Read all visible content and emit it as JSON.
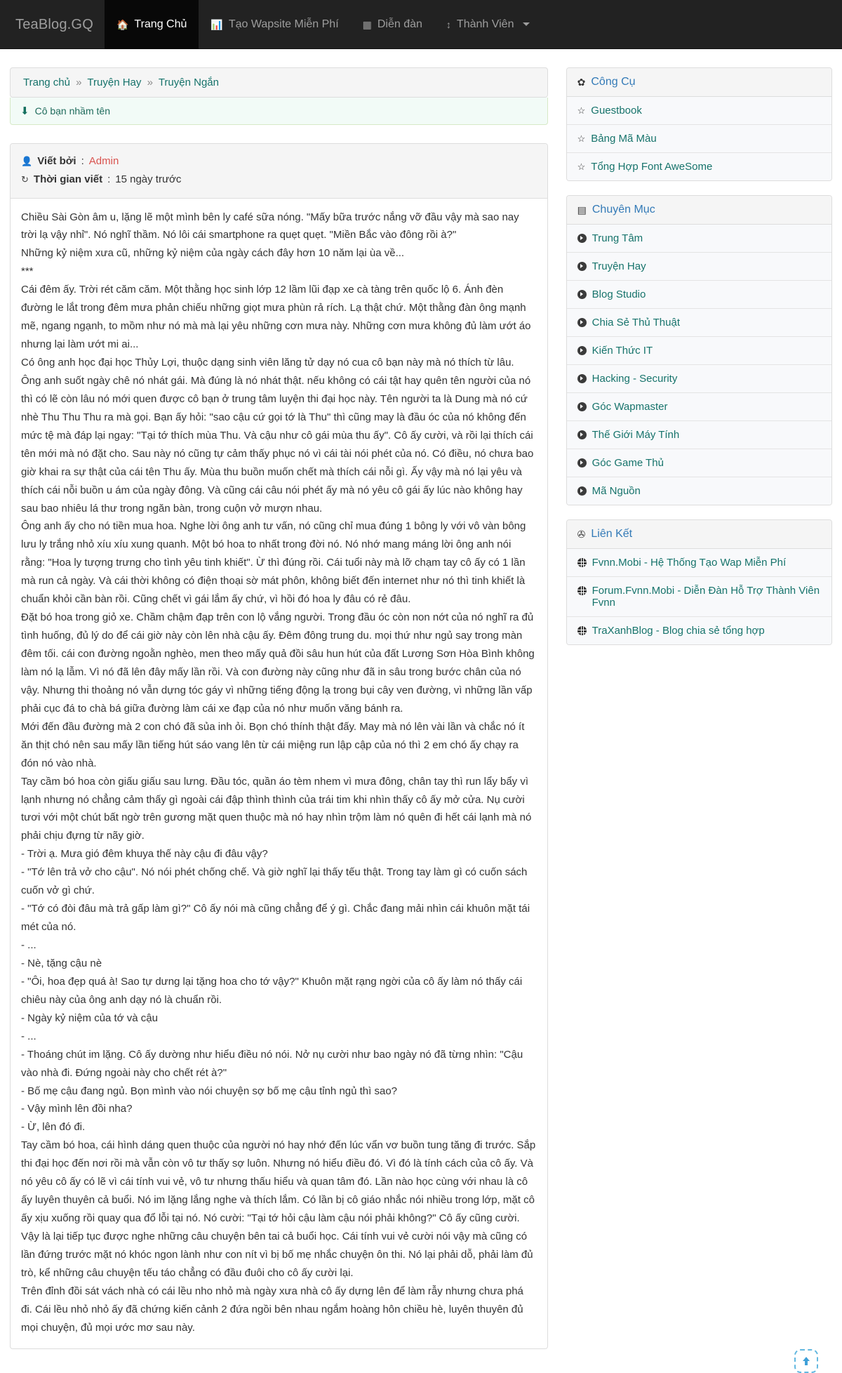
{
  "navbar": {
    "brand": "TeaBlog.GQ",
    "items": [
      {
        "label": "Trang Chủ",
        "icon": "home-icon",
        "glyph": "⌂",
        "active": true
      },
      {
        "label": "Tạo Wapsite Miễn Phí",
        "icon": "bar-chart-icon",
        "glyph": "ὌA",
        "active": false
      },
      {
        "label": "Diễn đàn",
        "icon": "table-icon",
        "glyph": "▦",
        "active": false
      },
      {
        "label": "Thành Viên",
        "icon": "arrows-v-icon",
        "glyph": "↕",
        "active": false,
        "caret": true
      }
    ]
  },
  "breadcrumb": {
    "items": [
      "Trang chủ",
      "Truyện Hay",
      "Truyện Ngắn"
    ],
    "separator": "»"
  },
  "post": {
    "title": "Cô bạn nhầm tên",
    "title_icon": "arrow-down-icon",
    "author_label": "Viết bởi",
    "author_name": "Admin",
    "time_label": "Thời gian viết",
    "time_value": "15 ngày trước",
    "paragraphs": [
      "Chiều Sài Gòn âm u, lặng lẽ một mình bên ly café sữa nóng. \"Mấy bữa trước nắng vỡ đầu vậy mà sao nay trời lạ vậy nhỉ\". Nó nghĩ thầm. Nó lôi cái smartphone ra quẹt quẹt. \"Miền Bắc vào đông rồi à?\"",
      "Những kỷ niệm xưa cũ, những kỷ niệm của ngày cách đây hơn 10 năm lại ùa về...",
      "***",
      "Cái đêm ấy. Trời rét căm căm. Một thằng học sinh lớp 12 lầm lũi đạp xe cà tàng trên quốc lộ 6. Ánh đèn đường le lắt trong đêm mưa phản chiếu những giọt mưa phùn rả rích. Lạ thật chứ. Một thằng đàn ông mạnh mẽ, ngang ngạnh, to mồm như nó mà mà lại yêu những cơn mưa này. Những cơn mưa không đủ làm ướt áo nhưng lại làm ướt mi ai...",
      "Có ông anh học đại học Thủy Lợi, thuộc dạng sinh viên lăng tử dạy nó cua cô bạn này mà nó thích từ lâu.",
      "Ông anh suốt ngày chê nó nhát gái. Mà đúng là nó nhát thật. nếu không có cái tật hay quên tên người của nó thì có lẽ còn lâu nó mới quen được cô bạn ở trung tâm luyện thi đại học này. Tên người ta là Dung mà nó cứ nhè Thu Thu Thu ra mà gọi. Bạn ấy hỏi: \"sao cậu cứ gọi tớ là Thu\" thì cũng may là đầu óc của nó không đến mức tệ mà đáp lại ngay: \"Tại tớ thích mùa Thu. Và cậu như cô gái mùa thu ấy\". Cô ấy cười, và rồi lại thích cái tên mới mà nó đặt cho. Sau này nó cũng tự cảm thấy phục nó vì cái tài nói phét của nó. Có điều, nó chưa bao giờ khai ra sự thật của cái tên Thu ấy. Mùa thu buồn muốn chết mà thích cái nỗi gì. Ấy vậy mà nó lại yêu và thích cái nỗi buồn u ám của ngày đông. Và cũng cái câu nói phét ấy mà nó yêu cô gái ấy lúc nào không hay sau bao nhiêu lá thư trong ngăn bàn, trong cuộn vở mượn nhau.",
      "Ông anh ấy cho nó tiền mua hoa. Nghe lời ông anh tư vấn, nó cũng chỉ mua đúng 1 bông ly với vô vàn bông lưu ly trắng nhỏ xíu xíu xung quanh. Một bó hoa to nhất trong đời nó. Nó nhớ mang máng lời ông anh nói rằng: \"Hoa ly tượng trưng cho tình yêu tinh khiết\". Ừ thì đúng rồi. Cái tuổi này mà lỡ chạm tay cô ấy có 1 lần mà run cả ngày. Và cái thời không có điện thoại sờ mát phôn, không biết đến internet như nó thì tinh khiết là chuẩn khỏi cần bàn rồi. Cũng chết vì gái lắm ấy chứ, vì hồi đó hoa ly đâu có rẻ đâu.",
      "Đặt bó hoa trong giỏ xe. Chầm chậm đạp trên con lộ vắng người. Trong đầu óc còn non nớt của nó nghĩ ra đủ tình huống, đủ lý do để cái giờ này còn lên nhà cậu ấy. Đêm đông trung du. mọi thứ như ngủ say trong màn đêm tối. cái con đường ngoằn nghèo, men theo mấy quả đồi sâu hun hút của đất Lương Sơn Hòa Bình không làm nó lạ lẫm. Vì nó đã lên đây mấy lần rồi. Và con đường này cũng như đã in sâu trong bước chân của nó vậy. Nhưng thi thoảng nó vẫn dựng tóc gáy vì những tiếng động lạ trong bụi cây ven đường, vì những lần vấp phải cục đá to chà bá giữa đường làm cái xe đạp của nó như muốn văng bánh ra.",
      "Mới đến đầu đường mà 2 con chó đã sủa inh ỏi. Bọn chó thính thật đấy. May mà nó lên vài lần và chắc nó ít ăn thịt chó nên sau mấy lần tiếng hút sáo vang lên từ cái miệng run lập cập của nó thì 2 em chó ấy chạy ra đón nó vào nhà.",
      "Tay cầm bó hoa còn giấu giấu sau lưng. Đầu tóc, quần áo tèm nhem vì mưa đông, chân tay thì run lẩy bẩy vì lạnh nhưng nó chẳng cảm thấy gì ngoài cái đập thình thình của trái tim khi nhìn thấy cô ấy mở cửa. Nụ cười tươi với một chút bất ngờ trên gương mặt quen thuộc mà nó hay nhìn trộm làm nó quên đi hết cái lạnh mà nó phải chịu đựng từ nãy giờ.",
      "- Trời ạ. Mưa gió đêm khuya thế này cậu đi đâu vậy?",
      "- \"Tớ lên trả vở cho cậu\". Nó nói phét chống chế. Và giờ nghĩ lại thấy tếu thật. Trong tay làm gì có cuốn sách cuốn vở gì chứ.",
      "- \"Tớ có đòi đâu mà trả gấp làm gì?\" Cô ấy nói mà cũng chẳng để ý gì. Chắc đang mải nhìn cái khuôn mặt tái mét của nó.",
      "- ...",
      "- Nè, tặng cậu nè",
      "- \"Ôi, hoa đẹp quá à! Sao tự dưng lại tặng hoa cho tớ vậy?\" Khuôn mặt rạng ngời của cô ấy làm nó thấy cái chiêu này của ông anh dạy nó là chuẩn rồi.",
      "- Ngày kỷ niệm của tớ và cậu",
      "- ...",
      "- Thoáng chút im lặng. Cô ấy dường như hiểu điều nó nói. Nở nụ cười như bao ngày nó đã từng nhìn: \"Cậu vào nhà đi. Đứng ngoài này cho chết rét à?\"",
      "- Bố mẹ cậu đang ngủ. Bọn mình vào nói chuyện sợ bố mẹ cậu tỉnh ngủ thì sao?",
      "- Vậy mình lên đồi nha?",
      "- Ừ, lên đó đi.",
      "Tay cầm bó hoa, cái hình dáng quen thuộc của người nó hay nhớ đến lúc vẩn vơ buồn tung tăng đi trước. Sắp thi đại học đến nơi rồi mà vẫn còn vô tư thấy sợ luôn. Nhưng nó hiểu điều đó. Vì đó là tính cách của cô ấy. Và nó yêu cô ấy có lẽ vì cái tính vui vẻ, vô tư nhưng thấu hiểu và quan tâm đó. Lần nào học cùng với nhau là cô ấy luyên thuyên cả buổi. Nó im lặng lắng nghe và thích lắm. Có lần bị cô giáo nhắc nói nhiều trong lớp, mặt cô ấy xịu xuống rồi quay qua đổ lỗi tại nó. Nó cười: \"Tại tớ hỏi cậu làm cậu nói phải không?\" Cô ấy cũng cười. Vậy là lại tiếp tục được nghe những câu chuyện bên tai cả buổi học. Cái tính vui vẻ cười nói vậy mà cũng có lần đứng trước mặt nó khóc ngon lành như con nít vì bị bố mẹ nhắc chuyện ôn thi. Nó lại phải dỗ, phải làm đủ trò, kể những câu chuyện tếu táo chẳng có đầu đuôi cho cô ấy cười lại.",
      "Trên đỉnh đồi sát vách nhà có cái lều nho nhỏ mà ngày xưa nhà cô ấy dựng lên để làm rẫy nhưng chưa phá đi. Cái lều nhỏ nhỏ ấy đã chứng kiến cảnh 2 đứa ngồi bên nhau ngắm hoàng hôn chiều hè, luyên thuyên đủ mọi chuyện, đủ mọi ước mơ sau này."
    ]
  },
  "sidebar": {
    "panels": [
      {
        "heading": "Công Cụ",
        "heading_icon": "gear-icon",
        "heading_glyph": "✿",
        "item_icon": "star-icon",
        "items": [
          {
            "label": "Guestbook"
          },
          {
            "label": "Bảng Mã Màu"
          },
          {
            "label": "Tổng Hợp Font AweSome"
          }
        ]
      },
      {
        "heading": "Chuyên Mục",
        "heading_icon": "list-alt-icon",
        "heading_glyph": "▤",
        "item_icon": "arrow-circle-right-icon",
        "items": [
          {
            "label": "Trung Tâm"
          },
          {
            "label": "Truyện Hay"
          },
          {
            "label": "Blog Studio"
          },
          {
            "label": "Chia Sẻ Thủ Thuật"
          },
          {
            "label": "Kiến Thức IT"
          },
          {
            "label": "Hacking - Security"
          },
          {
            "label": "Góc Wapmaster"
          },
          {
            "label": "Thế Giới Máy Tính"
          },
          {
            "label": "Góc Game Thủ"
          },
          {
            "label": "Mã Nguồn"
          }
        ]
      },
      {
        "heading": "Liên Kết",
        "heading_icon": "link-icon",
        "heading_glyph": "✇",
        "item_icon": "globe-icon",
        "items": [
          {
            "label": "Fvnn.Mobi - Hệ Thống Tạo Wap Miễn Phí"
          },
          {
            "label": "Forum.Fvnn.Mobi - Diễn Đàn Hỗ Trợ Thành Viên Fvnn"
          },
          {
            "label": "TraXanhBlog - Blog chia sẻ tổng hợp"
          }
        ]
      }
    ]
  },
  "scroll_top": {
    "icon": "scroll-to-top-icon",
    "color": "#63b8e0"
  },
  "colors": {
    "navbar_bg": "#222222",
    "navbar_active_bg": "#080808",
    "link_teal": "#16736b",
    "heading_blue": "#337ab7",
    "author_red": "#d9534f",
    "alert_bg": "#f2fbf7",
    "panel_head_bg": "#f5f5f5"
  }
}
